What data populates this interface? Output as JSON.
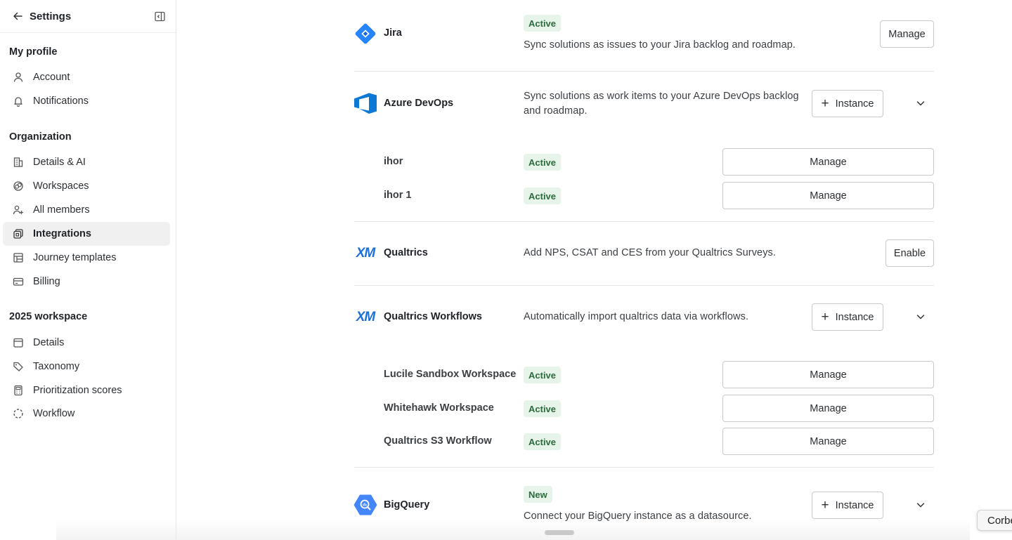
{
  "sidebar": {
    "title": "Settings",
    "sections": [
      {
        "label": "My profile",
        "items": [
          {
            "label": "Account",
            "icon": "user-icon"
          },
          {
            "label": "Notifications",
            "icon": "bell-icon"
          }
        ]
      },
      {
        "label": "Organization",
        "items": [
          {
            "label": "Details & AI",
            "icon": "building-icon"
          },
          {
            "label": "Workspaces",
            "icon": "workspaces-icon"
          },
          {
            "label": "All members",
            "icon": "members-icon"
          },
          {
            "label": "Integrations",
            "icon": "integrations-icon",
            "active": true
          },
          {
            "label": "Journey templates",
            "icon": "template-icon"
          },
          {
            "label": "Billing",
            "icon": "card-icon"
          }
        ]
      },
      {
        "label": "2025 workspace",
        "items": [
          {
            "label": "Details",
            "icon": "calendar-icon"
          },
          {
            "label": "Taxonomy",
            "icon": "tags-icon"
          },
          {
            "label": "Prioritization scores",
            "icon": "calculator-icon"
          },
          {
            "label": "Workflow",
            "icon": "dashed-circle-icon"
          }
        ]
      }
    ]
  },
  "integrations": {
    "jira": {
      "name": "Jira",
      "status": "Active",
      "description": "Sync solutions as issues to your Jira backlog and roadmap.",
      "button": "Manage"
    },
    "azure": {
      "name": "Azure DevOps",
      "description_line1": "Sync solutions as work items to your Azure DevOps backlog",
      "description_line2": "and roadmap.",
      "button": "Instance",
      "instances": [
        {
          "name": "ihor",
          "status": "Active",
          "button": "Manage"
        },
        {
          "name": "ihor 1",
          "status": "Active",
          "button": "Manage"
        }
      ]
    },
    "qualtrics": {
      "name": "Qualtrics",
      "logo_text": "XM",
      "description": "Add NPS, CSAT and CES from your Qualtrics Surveys.",
      "button": "Enable"
    },
    "qualtrics_workflows": {
      "name": "Qualtrics Workflows",
      "logo_text": "XM",
      "description": "Automatically import qualtrics data via workflows.",
      "button": "Instance",
      "instances": [
        {
          "name": "Lucile Sandbox Workspace",
          "status": "Active",
          "button": "Manage"
        },
        {
          "name": "Whitehawk Workspace",
          "status": "Active",
          "button": "Manage"
        },
        {
          "name": "Qualtrics S3 Workflow",
          "status": "Active",
          "button": "Manage"
        }
      ]
    },
    "bigquery": {
      "name": "BigQuery",
      "status": "New",
      "description": "Connect your BigQuery instance as a datasource.",
      "button": "Instance"
    }
  },
  "corner_chip": "Corbe",
  "colors": {
    "active_badge_bg": "#e6f4e9",
    "active_badge_text": "#2c6b3e",
    "jira_blue": "#2684ff",
    "azure_blue": "#0a78d4",
    "xm_blue": "#1a6fd8",
    "bigquery_blue": "#4386fa"
  }
}
